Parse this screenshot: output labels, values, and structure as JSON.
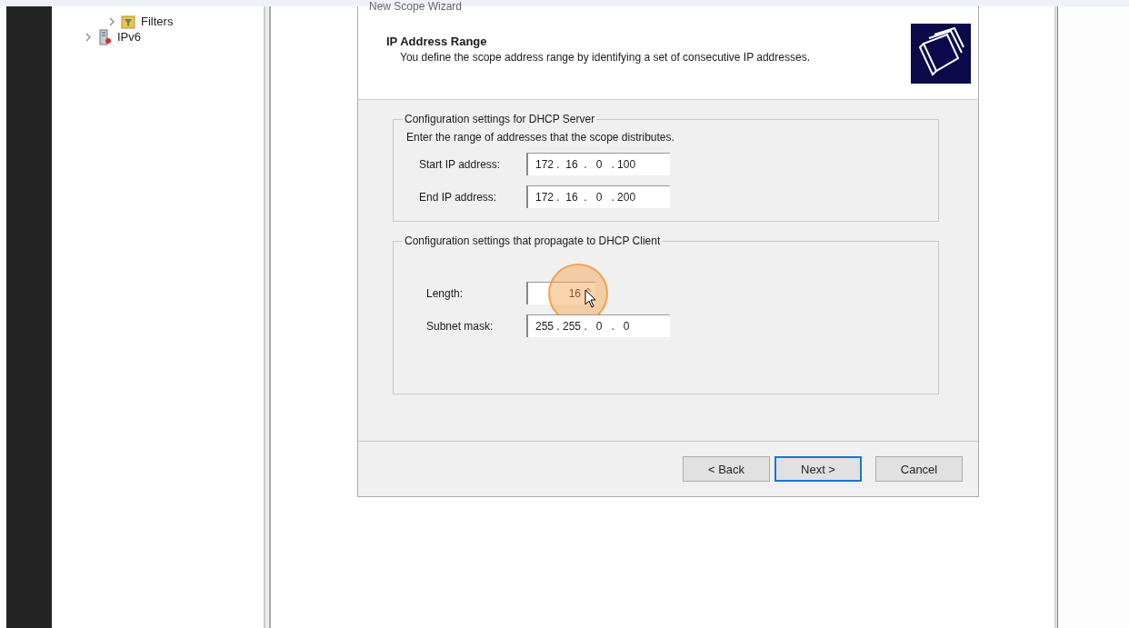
{
  "tree": {
    "items": [
      {
        "label": "Filters",
        "kind": "filter",
        "expanded": false
      },
      {
        "label": "IPv6",
        "kind": "server",
        "expanded": false
      }
    ]
  },
  "dialog": {
    "title": "New Scope Wizard",
    "heading": "IP Address Range",
    "subtitle": "You define the scope address range by identifying a set of consecutive IP addresses.",
    "groups": [
      {
        "title": "Configuration settings for DHCP Server",
        "intro": "Enter the range of addresses that the scope distributes.",
        "fields": [
          {
            "label": "Start IP address:",
            "kind": "ip",
            "value": "172 .  16  .   0   . 100"
          },
          {
            "label": "End IP address:",
            "kind": "ip",
            "value": "172 .  16  .   0   . 200"
          }
        ]
      },
      {
        "title": "Configuration settings that propagate to DHCP Client",
        "fields": [
          {
            "label": "Length:",
            "kind": "spin",
            "value": "16"
          },
          {
            "label": "Subnet mask:",
            "kind": "ip",
            "value": "255 . 255 .   0   .   0"
          }
        ]
      }
    ],
    "buttons": [
      {
        "label": "< Back",
        "selected": false
      },
      {
        "label": "Next >",
        "selected": true
      },
      {
        "label": "Cancel",
        "selected": false
      }
    ]
  }
}
